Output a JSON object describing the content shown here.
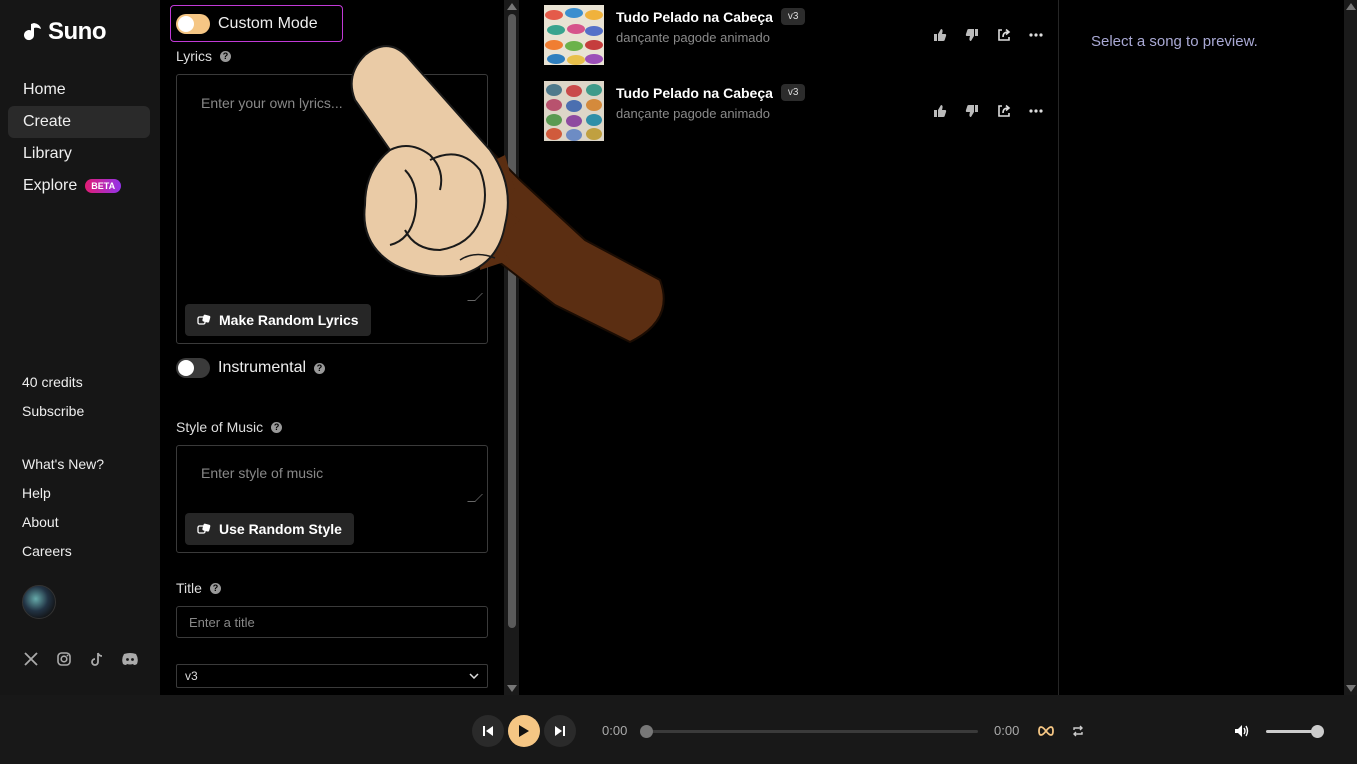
{
  "app": {
    "name": "Suno"
  },
  "nav": [
    {
      "label": "Home"
    },
    {
      "label": "Create",
      "active": true
    },
    {
      "label": "Library"
    },
    {
      "label": "Explore",
      "badge": "BETA"
    }
  ],
  "account": {
    "credits": "40 credits",
    "subscribe": "Subscribe"
  },
  "links": [
    "What's New?",
    "Help",
    "About",
    "Careers"
  ],
  "form": {
    "custom_mode_label": "Custom Mode",
    "custom_mode_on": true,
    "lyrics_label": "Lyrics",
    "lyrics_placeholder": "Enter your own lyrics...",
    "random_lyrics_button": "Make Random Lyrics",
    "instrumental_label": "Instrumental",
    "instrumental_on": false,
    "style_label": "Style of Music",
    "style_placeholder": "Enter style of music",
    "random_style_button": "Use Random Style",
    "title_label": "Title",
    "title_placeholder": "Enter a title",
    "model_selected": "v3"
  },
  "songs": [
    {
      "title": "Tudo Pelado na Cabeça",
      "version": "v3",
      "style": "dançante pagode animado"
    },
    {
      "title": "Tudo Pelado na Cabeça",
      "version": "v3",
      "style": "dançante pagode animado"
    }
  ],
  "preview": {
    "empty_text": "Select a song to preview."
  },
  "player": {
    "current_time": "0:00",
    "duration": "0:00",
    "progress": 0,
    "volume": 1
  },
  "colors": {
    "accent": "#f5c684",
    "highlight_border": "#c13ad6",
    "badge_from": "#e11d74",
    "badge_to": "#9333ea"
  }
}
